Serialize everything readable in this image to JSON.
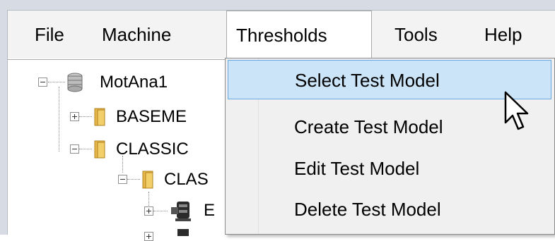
{
  "menubar": {
    "items": [
      {
        "label": "File"
      },
      {
        "label": "Machine"
      },
      {
        "label": "Thresholds",
        "open": true
      },
      {
        "label": "Tools"
      },
      {
        "label": "Help"
      }
    ]
  },
  "tree": {
    "nodes": [
      {
        "label": "MotAna1",
        "icon": "database-icon",
        "expander": "minus"
      },
      {
        "label": "BASEME",
        "icon": "folder-icon",
        "expander": "plus"
      },
      {
        "label": "CLASSIC",
        "icon": "folder-icon",
        "expander": "minus"
      },
      {
        "label": "CLAS",
        "icon": "folder-icon",
        "expander": "minus"
      },
      {
        "label": "E",
        "icon": "motor-icon",
        "expander": "plus"
      }
    ]
  },
  "dropdown": {
    "items": [
      {
        "label": "Select Test Model",
        "highlighted": true
      },
      {
        "label": "Create Test Model"
      },
      {
        "label": "Edit Test Model"
      },
      {
        "label": "Delete Test Model"
      }
    ]
  },
  "colors": {
    "highlight_bg": "#cce4f7",
    "highlight_border": "#66a7e0",
    "menu_bg": "#f0f0f0",
    "folder": "#e8b84a"
  },
  "cursor": {
    "icon": "mouse-pointer-icon"
  }
}
